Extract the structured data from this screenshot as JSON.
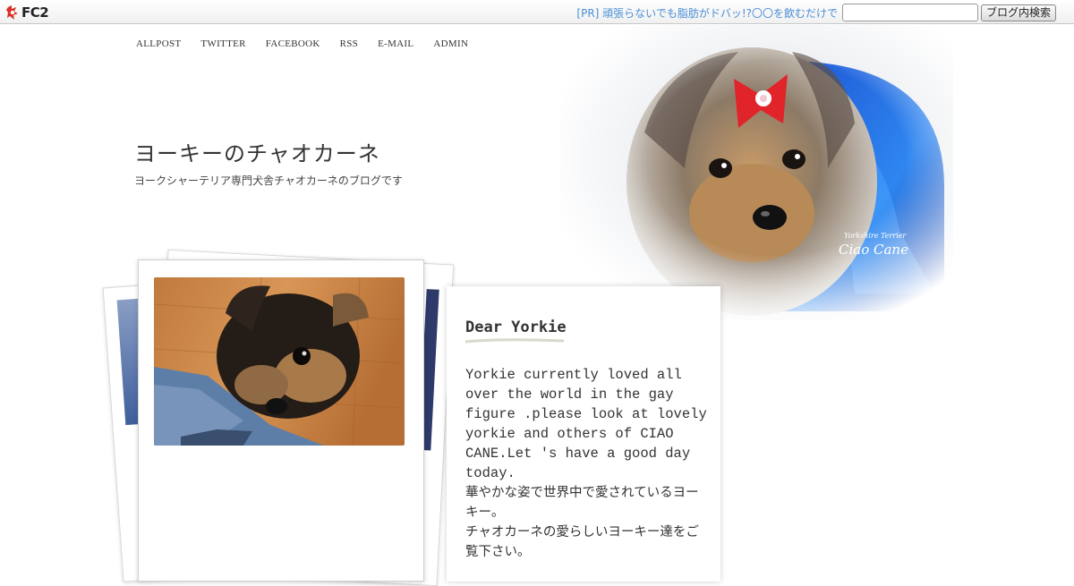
{
  "fc2_bar": {
    "logo_text": "FC2",
    "pr_text": "[PR] 頑張らないでも脂肪がドバッ!?〇〇を飲むだけで",
    "search_value": "",
    "search_button": "ブログ内検索"
  },
  "nav": {
    "items": [
      "ALLPOST",
      "TWITTER",
      "FACEBOOK",
      "RSS",
      "E-MAIL",
      "ADMIN"
    ]
  },
  "blog": {
    "title": "ヨーキーのチャオカーネ",
    "description": "ヨークシャーテリア専門犬舎チャオカーネのブログです"
  },
  "hero": {
    "caption_small": "Yorkshire Terrier",
    "caption_large": "Ciao Cane"
  },
  "about_card": {
    "title": "Dear Yorkie",
    "body_en": "Yorkie currently loved all over the world in the gay figure .please look at lovely yorkie and others of CIAO CANE.Let 's have a good day today.",
    "body_jp_1": "華やかな姿で世界中で愛されているヨーキー。",
    "body_jp_2": "チャオカーネの愛らしいヨーキー達をご覧下さい。"
  },
  "colors": {
    "link_blue": "#4a8ed6",
    "text_dark": "#333333"
  }
}
